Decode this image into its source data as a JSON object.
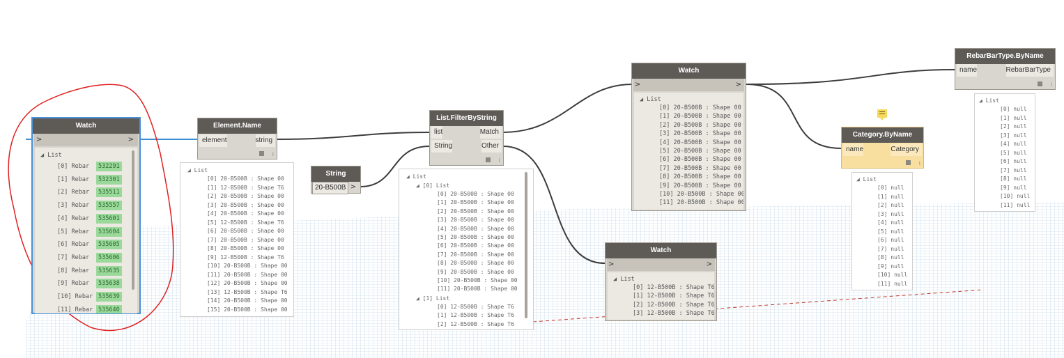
{
  "watch_left": {
    "title": "Watch",
    "in_arrow": ">",
    "out_arrow": ">",
    "list_label": "List",
    "items": [
      {
        "index": "[0] Rebar",
        "id": "532291"
      },
      {
        "index": "[1] Rebar",
        "id": "532301"
      },
      {
        "index": "[2] Rebar",
        "id": "535511"
      },
      {
        "index": "[3] Rebar",
        "id": "535557"
      },
      {
        "index": "[4] Rebar",
        "id": "535601"
      },
      {
        "index": "[5] Rebar",
        "id": "535604"
      },
      {
        "index": "[6] Rebar",
        "id": "535605"
      },
      {
        "index": "[7] Rebar",
        "id": "535606"
      },
      {
        "index": "[8] Rebar",
        "id": "535635"
      },
      {
        "index": "[9] Rebar",
        "id": "535638"
      },
      {
        "index": "[10] Rebar",
        "id": "535639"
      },
      {
        "index": "[11] Rebar",
        "id": "535640"
      }
    ]
  },
  "element_name": {
    "title": "Element.Name",
    "input": "element",
    "output": "string",
    "list_label": "List",
    "items": [
      "[0] 20-B500B : Shape 00",
      "[1] 12-B500B : Shape T6",
      "[2] 20-B500B : Shape 00",
      "[3] 20-B500B : Shape 00",
      "[4] 20-B500B : Shape 00",
      "[5] 12-B500B : Shape T6",
      "[6] 20-B500B : Shape 00",
      "[7] 20-B500B : Shape 00",
      "[8] 20-B500B : Shape 00",
      "[9] 12-B500B : Shape T6",
      "[10] 20-B500B : Shape 00",
      "[11] 20-B500B : Shape 00",
      "[12] 20-B500B : Shape 00",
      "[13] 12-B500B : Shape T6",
      "[14] 20-B500B : Shape 00",
      "[15] 20-B500B : Shape 00"
    ]
  },
  "string_node": {
    "title": "String",
    "value": "20-B500B",
    "out_arrow": ">"
  },
  "filter": {
    "title": "List.FilterByString",
    "input1": "list",
    "input2": "String",
    "output1": "Match",
    "output2": "Other",
    "list_label": "List",
    "sub0_label": "[0] List",
    "sub0_items": [
      "[0] 20-B500B : Shape 00",
      "[1] 20-B500B : Shape 00",
      "[2] 20-B500B : Shape 00",
      "[3] 20-B500B : Shape 00",
      "[4] 20-B500B : Shape 00",
      "[5] 20-B500B : Shape 00",
      "[6] 20-B500B : Shape 00",
      "[7] 20-B500B : Shape 00",
      "[8] 20-B500B : Shape 00",
      "[9] 20-B500B : Shape 00",
      "[10] 20-B500B : Shape 00",
      "[11] 20-B500B : Shape 00"
    ],
    "sub1_label": "[1] List",
    "sub1_items": [
      "[0] 12-B500B : Shape T6",
      "[1] 12-B500B : Shape T6",
      "[2] 12-B500B : Shape T6"
    ]
  },
  "watch_top": {
    "title": "Watch",
    "in_arrow": ">",
    "out_arrow": ">",
    "list_label": "List",
    "items": [
      "[0] 20-B500B : Shape 00",
      "[1] 20-B500B : Shape 00",
      "[2] 20-B500B : Shape 00",
      "[3] 20-B500B : Shape 00",
      "[4] 20-B500B : Shape 00",
      "[5] 20-B500B : Shape 00",
      "[6] 20-B500B : Shape 00",
      "[7] 20-B500B : Shape 00",
      "[8] 20-B500B : Shape 00",
      "[9] 20-B500B : Shape 00",
      "[10] 20-B500B : Shape 00",
      "[11] 20-B500B : Shape 00"
    ]
  },
  "watch_bottom": {
    "title": "Watch",
    "in_arrow": ">",
    "out_arrow": ">",
    "list_label": "List",
    "items": [
      "[0] 12-B500B : Shape T6",
      "[1] 12-B500B : Shape T6",
      "[2] 12-B500B : Shape T6",
      "[3] 12-B500B : Shape T6"
    ]
  },
  "category": {
    "title": "Category.ByName",
    "input": "name",
    "output": "Category",
    "list_label": "List",
    "items": [
      "[0] null",
      "[1] null",
      "[2] null",
      "[3] null",
      "[4] null",
      "[5] null",
      "[6] null",
      "[7] null",
      "[8] null",
      "[9] null",
      "[10] null",
      "[11] null"
    ]
  },
  "rebar_type": {
    "title": "RebarBarType.ByName",
    "input": "name",
    "output": "RebarBarType",
    "list_label": "List",
    "items": [
      "[0] null",
      "[1] null",
      "[2] null",
      "[3] null",
      "[4] null",
      "[5] null",
      "[6] null",
      "[7] null",
      "[8] null",
      "[9] null",
      "[10] null",
      "[11] null"
    ]
  },
  "colors": {
    "node_header": "#5e5b57",
    "node_body": "#d9d6cf",
    "selection": "#4a90d9",
    "selected_wire": "#3d8fd4",
    "wire": "#3c3c3c",
    "annotation": "#e02020",
    "warning_node": "#f8dfa0"
  }
}
